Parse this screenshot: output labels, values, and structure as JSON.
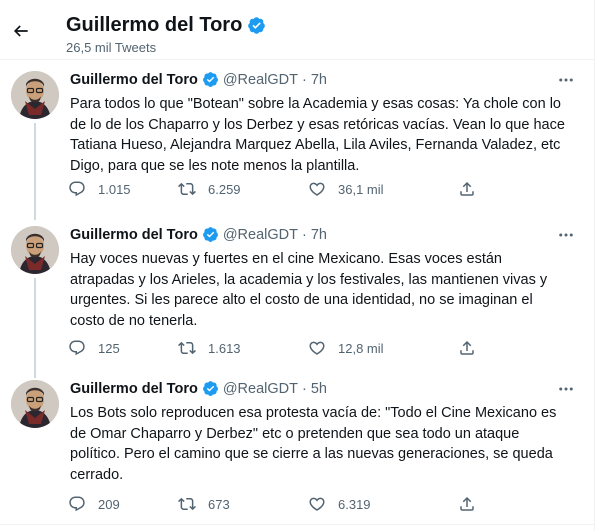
{
  "header": {
    "back_icon": "arrow-left-icon",
    "name": "Guillermo del Toro",
    "tweet_count": "26,5 mil Tweets",
    "verified_icon": "verified-badge-icon",
    "colors": {
      "verified": "#1d9bf0",
      "secondary_text": "#536471"
    }
  },
  "tweets": [
    {
      "name": "Guillermo del Toro",
      "handle": "@RealGDT",
      "time": "7h",
      "text": "Para todos lo que \"Botean\" sobre la Academia y esas cosas: Ya chole con lo de lo de los Chaparro y los Derbez y esas retóricas vacías. Vean lo que hace Tatiana Hueso, Alejandra Marquez Abella, Lila Aviles, Fernanda Valadez, etc  Digo, para que se les note menos la plantilla.",
      "replies": "1.015",
      "retweets": "6.259",
      "likes": "36,1 mil"
    },
    {
      "name": "Guillermo del Toro",
      "handle": "@RealGDT",
      "time": "7h",
      "text": "Hay voces nuevas y fuertes en el cine Mexicano.  Esas voces están atrapadas y los Arieles, la academia y los festivales, las mantienen vivas y urgentes.  Si les parece alto el costo de una identidad, no se imaginan el costo de no tenerla.",
      "replies": "125",
      "retweets": "1.613",
      "likes": "12,8 mil"
    },
    {
      "name": "Guillermo del Toro",
      "handle": "@RealGDT",
      "time": "5h",
      "text": "Los Bots solo reproducen esa protesta vacía de:  \"Todo el Cine Mexicano es de Omar Chaparro y Derbez\" etc o pretenden que sea todo un ataque político.  Pero el camino que se cierre a las nuevas generaciones, se queda cerrado.",
      "replies": "209",
      "retweets": "673",
      "likes": "6.319"
    }
  ]
}
